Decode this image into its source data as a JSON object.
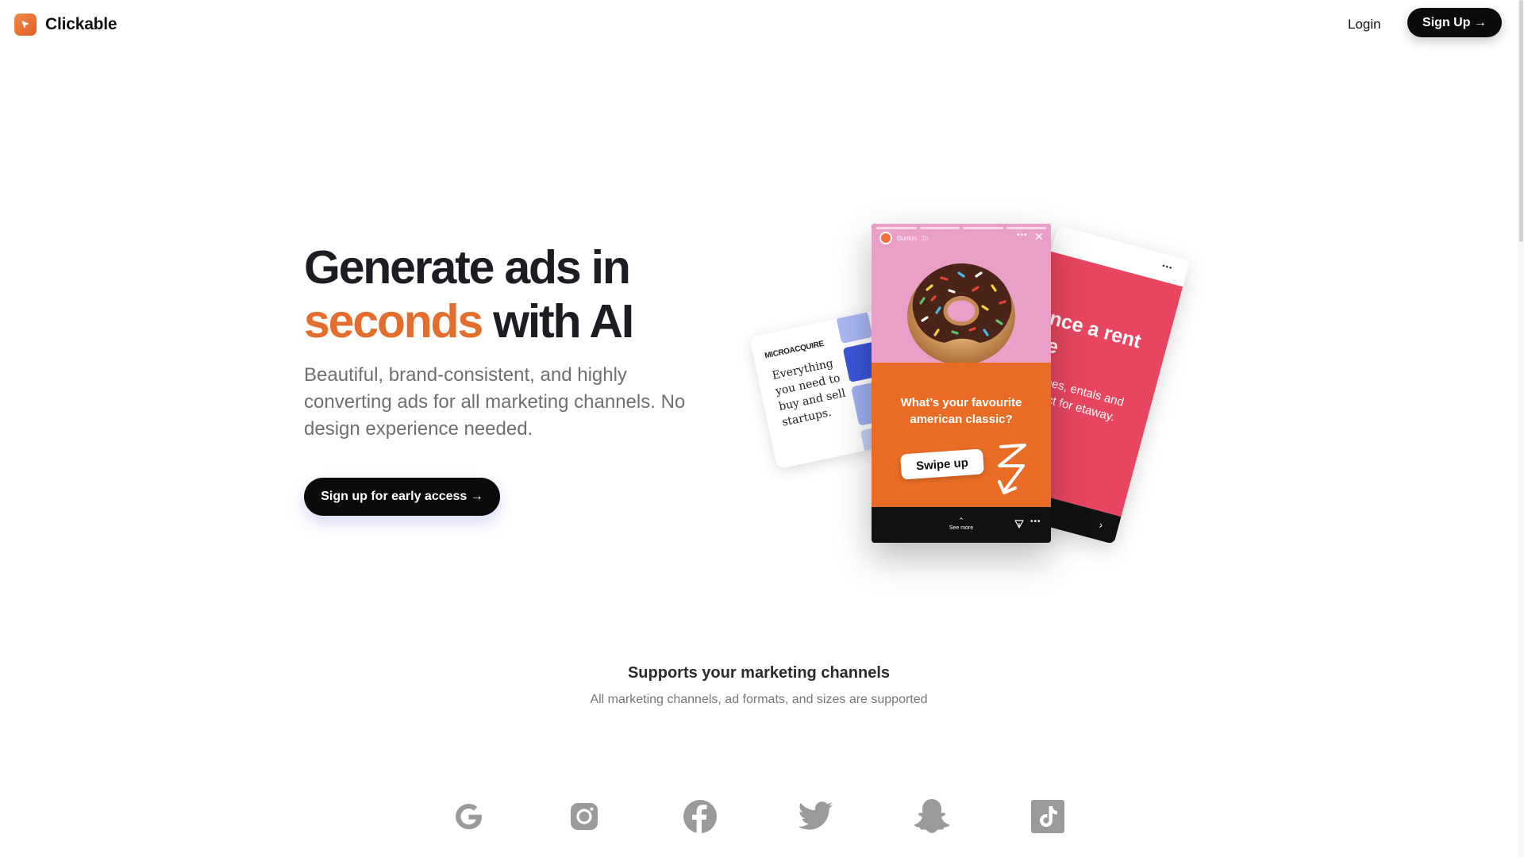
{
  "header": {
    "brand_name": "Clickable",
    "login_label": "Login",
    "signup_label": "Sign Up →"
  },
  "hero": {
    "title_line1": "Generate ads in",
    "title_accent": "seconds",
    "title_rest": " with AI",
    "subtitle": "Beautiful, brand-consistent, and highly converting ads for all marketing channels. No design experience needed.",
    "cta_label": "Sign up for early access →"
  },
  "ad_preview": {
    "left_card_brand": "MICROACQUIRE",
    "left_card_text": "Everything you need to buy and sell startups.",
    "story_user": "Dunkin",
    "story_time": "1h",
    "story_question": "What’s your favourite american classic?",
    "story_swipe": "Swipe up",
    "story_see_more": "See more",
    "right_card_title": "erience a rent place",
    "right_card_body": "que homes, entals and ins perfect for etaway."
  },
  "channels": {
    "title": "Supports your marketing channels",
    "subtitle": "All marketing channels, ad formats, and sizes are supported",
    "icons": [
      "google-icon",
      "instagram-icon",
      "facebook-icon",
      "twitter-icon",
      "snapchat-icon",
      "tiktok-icon"
    ]
  },
  "colors": {
    "accent": "#e36d2c",
    "button_bg": "#0b0b0b",
    "story_pink": "#ea9fc8",
    "story_orange": "#e86c25",
    "card_red": "#e84660",
    "icon_gray": "#9a9a9a"
  }
}
